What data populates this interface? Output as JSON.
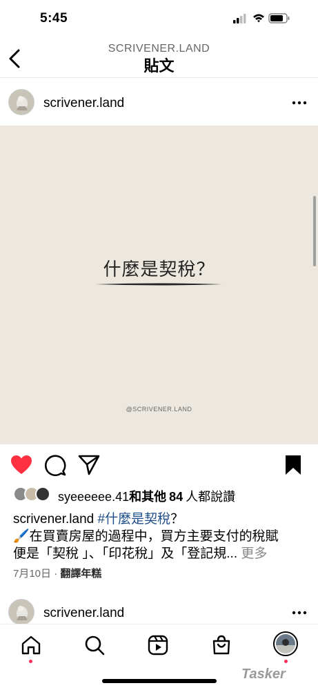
{
  "status_bar": {
    "time": "5:45"
  },
  "header": {
    "account": "SCRIVENER.LAND",
    "title": "貼文"
  },
  "post": {
    "username": "scrivener.land",
    "image": {
      "heading": "什麼是契稅？",
      "watermark": "@SCRIVENER.LAND"
    },
    "likes": {
      "user": "syeeeeee.41",
      "and_others": "和其他",
      "count": "84",
      "suffix": "人都說讚"
    },
    "caption": {
      "username": "scrivener.land",
      "hashtag": "#什麼是契稅",
      "hashtag_suffix": "？",
      "emoji": "🖌️",
      "line1": "在買賣房屋的過程中，買方主要支付的稅賦",
      "line2": "便是「契稅 」、「印花稅」及「登記規...",
      "more": "更多"
    },
    "date": "7月10日",
    "translate": "翻譯年糕"
  },
  "next_post": {
    "username": "scrivener.land"
  },
  "bottom_nav": [
    "home-tab",
    "search-tab",
    "reels-tab",
    "shop-tab",
    "profile-tab"
  ],
  "watermark": "Tasker",
  "colors": {
    "like_red": "#ff3040",
    "hashtag": "#1d4e89",
    "notification_dot": "#ff2d55"
  }
}
